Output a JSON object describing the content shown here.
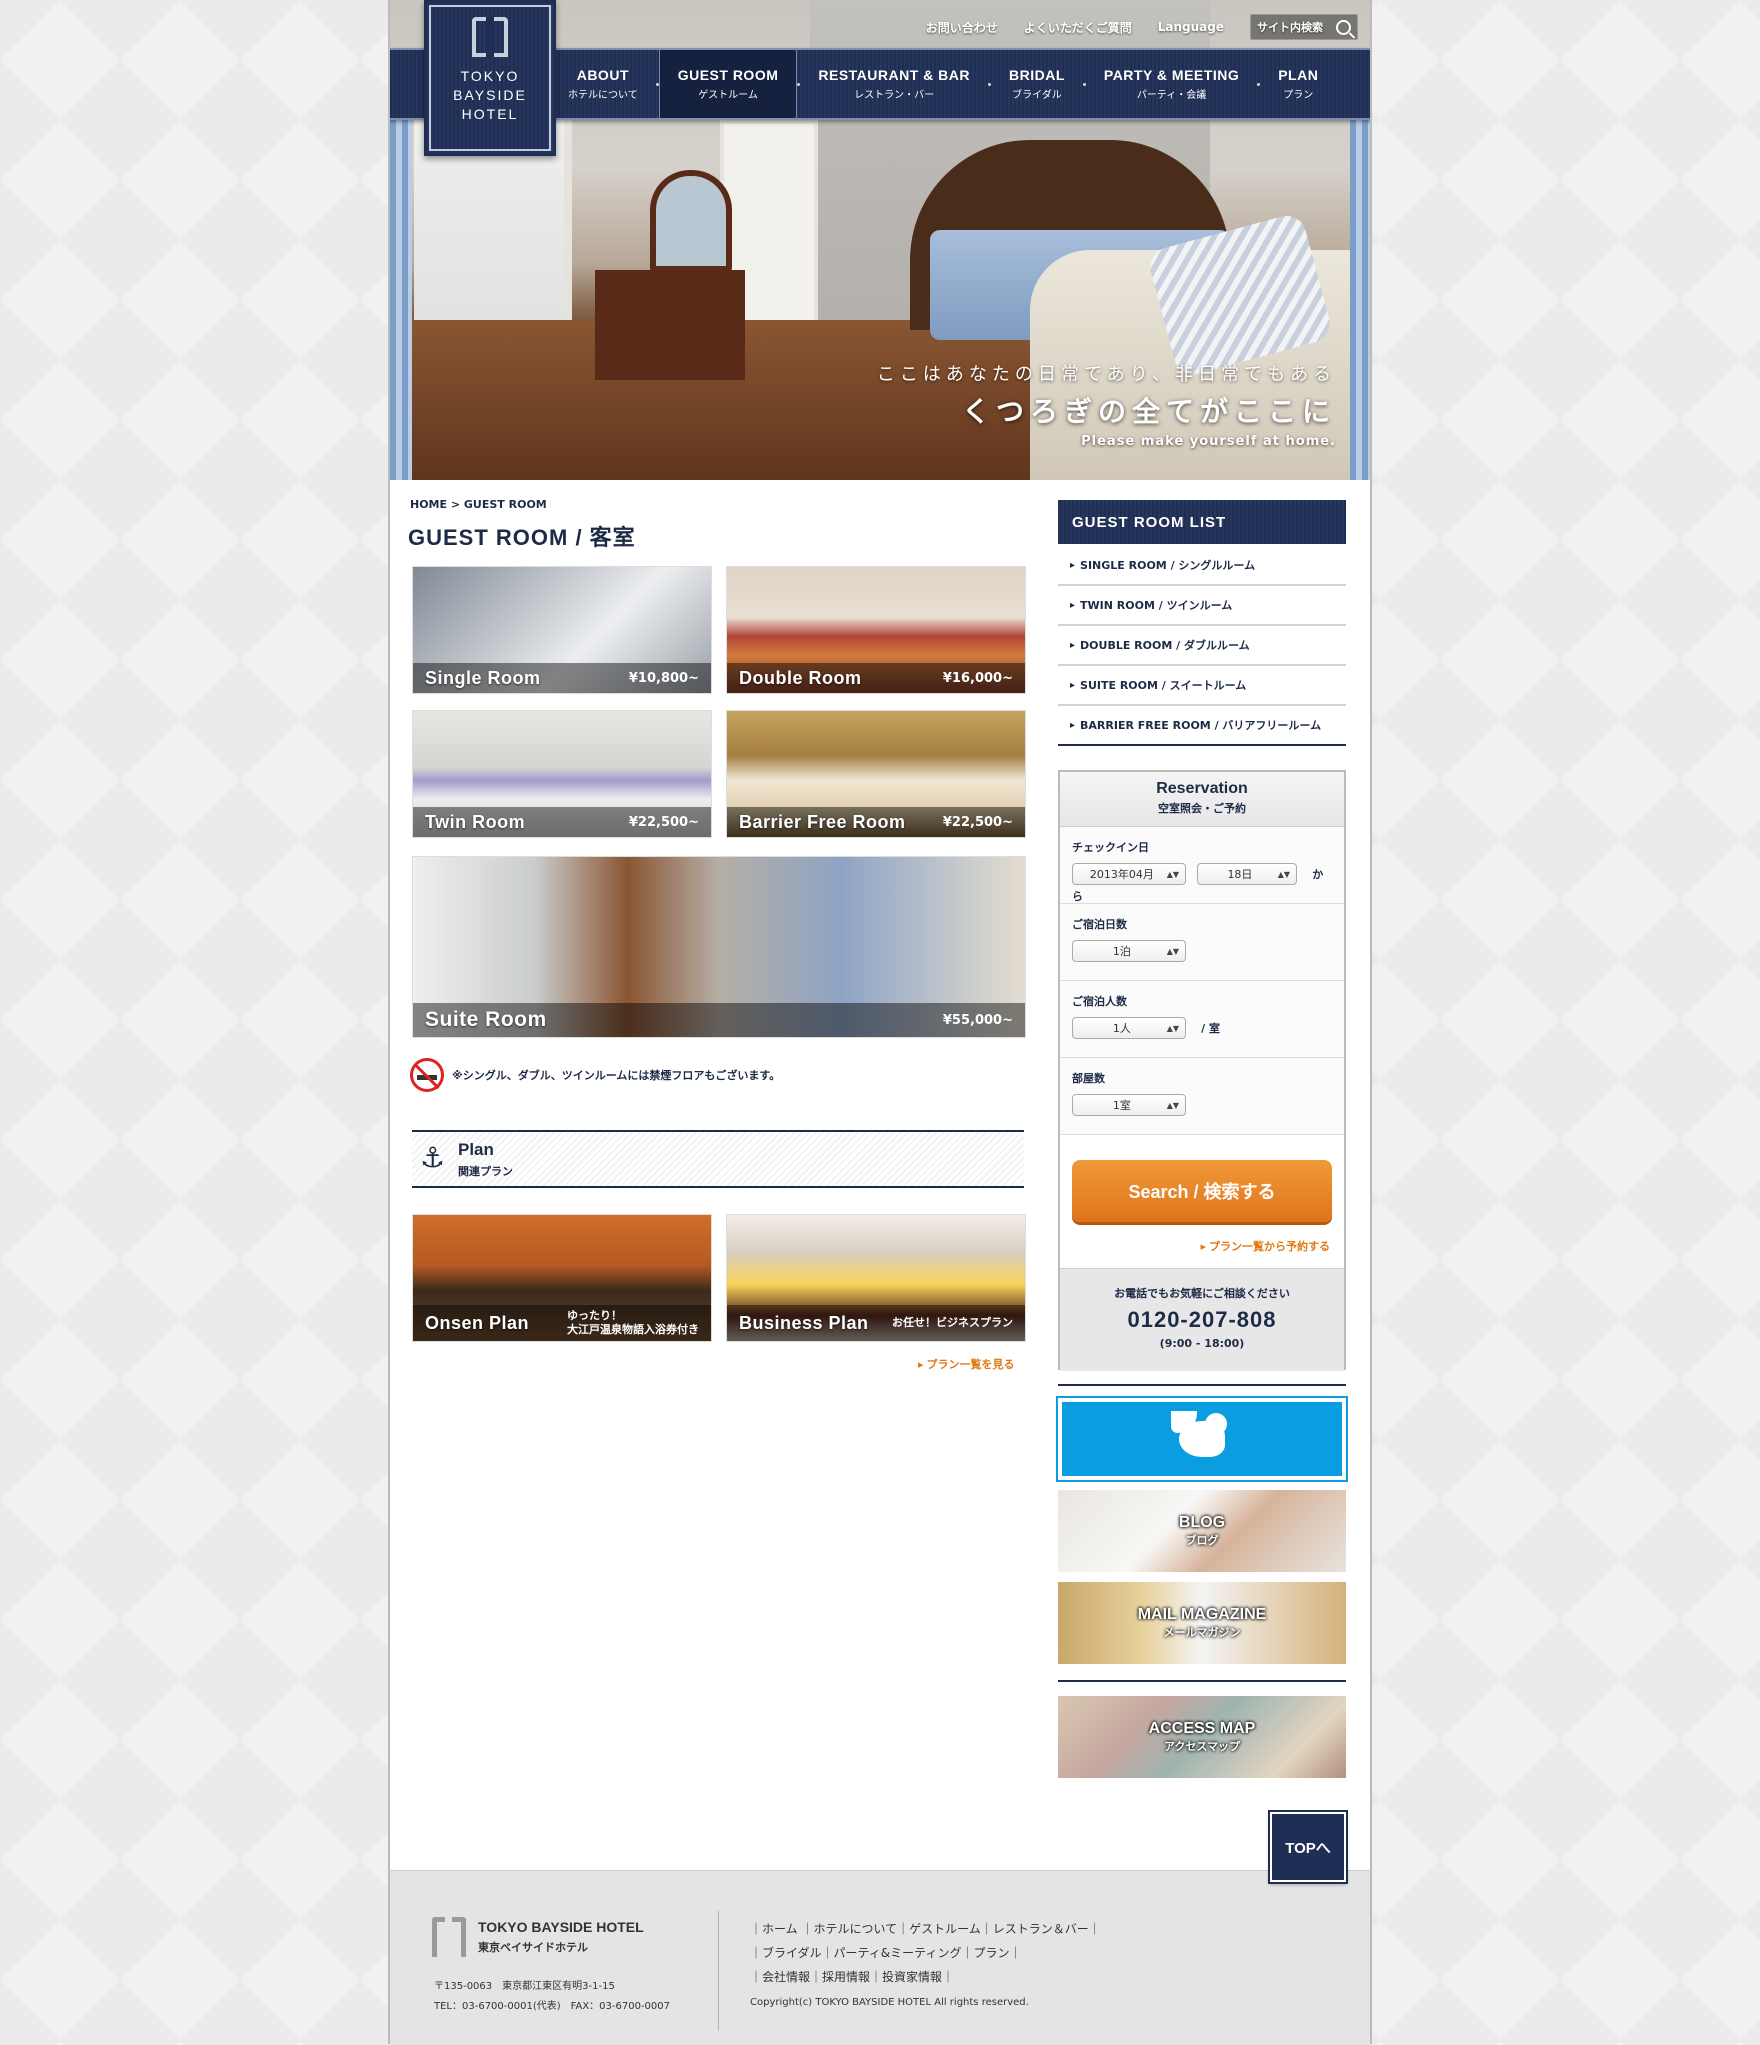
{
  "util": {
    "contact": "お問い合わせ",
    "faq": "よくいただくご質問",
    "language": "Language",
    "search_placeholder": "サイト内検索"
  },
  "logo": {
    "line1": "TOKYO",
    "line2": "BAYSIDE",
    "line3": "HOTEL"
  },
  "nav": [
    {
      "en": "ABOUT",
      "ja": "ホテルについて"
    },
    {
      "en": "GUEST ROOM",
      "ja": "ゲストルーム"
    },
    {
      "en": "RESTAURANT & BAR",
      "ja": "レストラン・バー"
    },
    {
      "en": "BRIDAL",
      "ja": "ブライダル"
    },
    {
      "en": "PARTY & MEETING",
      "ja": "パーティ・会議"
    },
    {
      "en": "PLAN",
      "ja": "プラン"
    }
  ],
  "hero": {
    "copy1": "ここはあなたの日常であり、非日常でもある",
    "copy2": "くつろぎの全てがここに",
    "copy3": "Please make yourself at home."
  },
  "breadcrumb": "HOME > GUEST ROOM",
  "page_title": "GUEST ROOM / 客室",
  "rooms": [
    {
      "name": "Single Room",
      "price": "¥10,800~"
    },
    {
      "name": "Double Room",
      "price": "¥16,000~"
    },
    {
      "name": "Twin Room",
      "price": "¥22,500~"
    },
    {
      "name": "Barrier Free Room",
      "price": "¥22,500~"
    },
    {
      "name": "Suite Room",
      "price": "¥55,000~"
    }
  ],
  "nonsmoking_note": "※シングル、ダブル、ツインルームには禁煙フロアもございます。",
  "plan_section": {
    "en": "Plan",
    "ja": "関連プラン"
  },
  "plans": [
    {
      "name": "Onsen Plan",
      "sub1": "ゆったり！",
      "sub2": "大江戸温泉物語入浴券付き"
    },
    {
      "name": "Business Plan",
      "sub1": "お任せ！ビジネスプラン"
    }
  ],
  "plan_list_link": "プラン一覧を見る",
  "sidebar": {
    "title": "GUEST ROOM LIST",
    "items": [
      "SINGLE ROOM / シングルルーム",
      "TWIN ROOM / ツインルーム",
      "DOUBLE ROOM / ダブルルーム",
      "SUITE ROOM / スイートルーム",
      "BARRIER FREE ROOM / バリアフリールーム"
    ]
  },
  "reservation": {
    "title": "Reservation",
    "subtitle": "空室照会・ご予約",
    "checkin_label": "チェックイン日",
    "checkin_month": "2013年04月",
    "checkin_day": "18日",
    "from": "から",
    "nights_label": "ご宿泊日数",
    "nights": "1泊",
    "guests_label": "ご宿泊人数",
    "guests": "1人",
    "per_room": "/ 室",
    "rooms_label": "部屋数",
    "rooms": "1室",
    "search_button": "Search / 検索する",
    "plan_reserve_link": "プラン一覧から予約する",
    "phone_note": "お電話でもお気軽にご相談ください",
    "phone": "0120-207-808",
    "hours": "(9:00 - 18:00)"
  },
  "banners": {
    "blog": {
      "en": "BLOG",
      "ja": "ブログ"
    },
    "mail": {
      "en": "MAIL MAGAZINE",
      "ja": "メールマガジン"
    },
    "access": {
      "en": "ACCESS MAP",
      "ja": "アクセスマップ"
    }
  },
  "top_button": "TOPへ",
  "footer": {
    "name": "TOKYO BAYSIDE HOTEL",
    "name_ja": "東京ベイサイドホテル",
    "address": "〒135-0063　東京都江東区有明3-1-15",
    "tel": "TEL：03-6700-0001(代表)　FAX：03-6700-0007",
    "links_row1": "｜ホーム ｜ホテルについて｜ゲストルーム｜レストラン＆バー｜",
    "links_row2": "｜ブライダル｜パーティ&ミーティング｜プラン｜",
    "links_row3": "｜会社情報｜採用情報｜投資家情報｜",
    "copyright": "Copyright(c) TOKYO BAYSIDE HOTEL All rights reserved."
  },
  "colors": {
    "navy": "#1f2e55",
    "accent": "#e07a16",
    "twitter": "#0a9de0"
  }
}
